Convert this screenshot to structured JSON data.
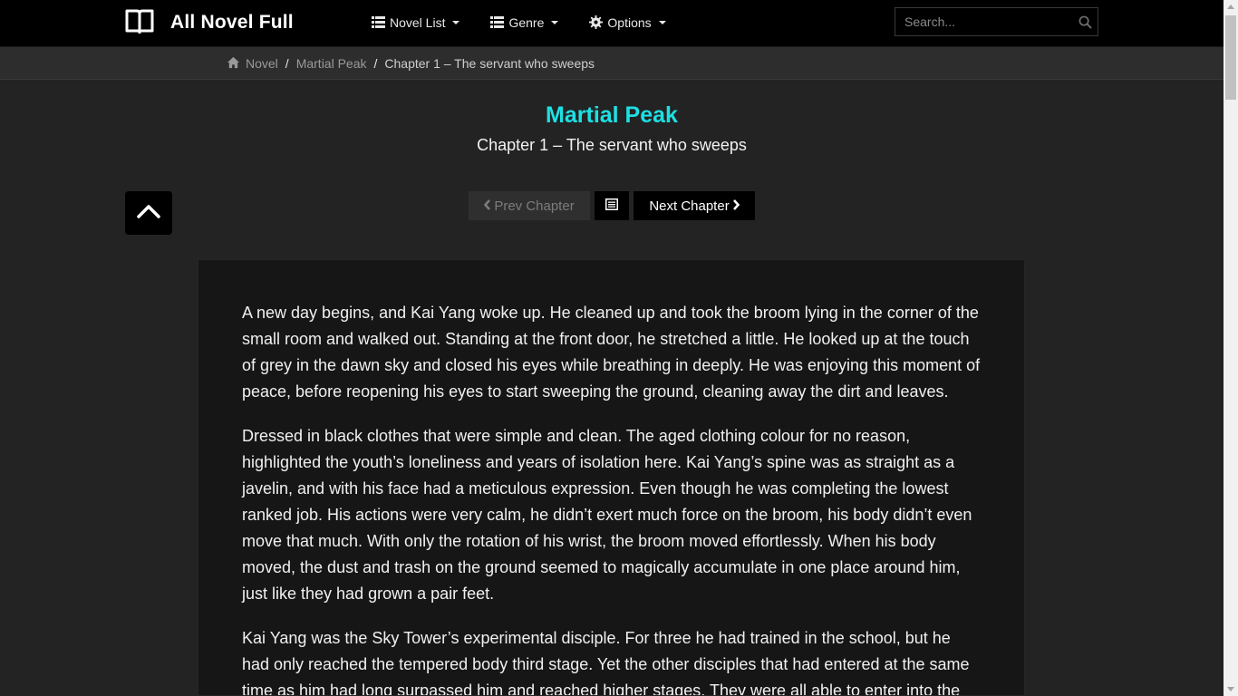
{
  "brand": {
    "name": "All Novel Full"
  },
  "nav": {
    "items": [
      {
        "label": "Novel List",
        "icon": "list-icon"
      },
      {
        "label": "Genre",
        "icon": "list-icon"
      },
      {
        "label": "Options",
        "icon": "gear-icon"
      }
    ]
  },
  "search": {
    "placeholder": "Search...",
    "icon": "search-icon"
  },
  "breadcrumb": {
    "home": "Novel",
    "novel": "Martial Peak",
    "current": "Chapter 1 – The servant who sweeps",
    "separator": "/"
  },
  "novel_title": "Martial Peak",
  "chapter_title": "Chapter 1 – The servant who sweeps",
  "chapter_nav": {
    "prev_label": "Prev Chapter",
    "next_label": "Next Chapter"
  },
  "content": {
    "paragraphs": [
      "A new day begins, and Kai Yang woke up. He cleaned up and took the broom lying in the corner of the small room and walked out. Standing at the front door, he stretched a little. He looked up at the touch of grey in the dawn sky and closed his eyes while breathing in deeply. He was enjoying this moment of peace, before reopening his eyes to start sweeping the ground, cleaning away the dirt and leaves.",
      "Dressed in black clothes that were simple and clean. The aged clothing colour for no reason, highlighted the youth’s loneliness and years of isolation here. Kai Yang’s spine was as straight as a javelin, and with his face had a meticulous expression. Even though he was completing the lowest ranked job. His actions were very calm, he didn’t exert much force on the broom, his body didn’t even move that much. With only the rotation of his wrist, the broom moved effortlessly. When his body moved, the dust and trash on the ground seemed to magically accumulate in one place around him, just like they had grown a pair feet.",
      "Kai Yang was the Sky Tower’s experimental disciple. For three he had trained in the school, but he had only reached the tempered body third stage. Yet the other disciples that had entered at the same time as him had long surpassed him and reached higher stages. They were all able to enter into the main"
    ]
  },
  "colors": {
    "accent": "#1ee0e3",
    "background": "#232323",
    "navbar": "#000000",
    "content_bg": "#161616"
  }
}
